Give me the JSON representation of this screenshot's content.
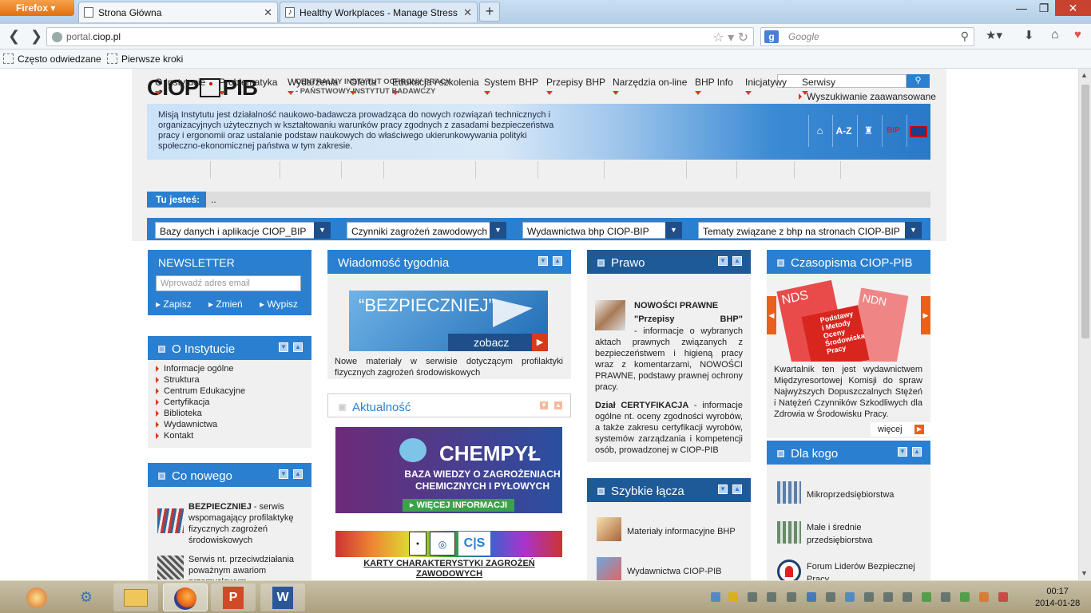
{
  "browser": {
    "menu_button": "Firefox",
    "tabs": [
      {
        "title": "Strona Główna",
        "active": true
      },
      {
        "title": "Healthy Workplaces - Manage Stress",
        "active": false
      }
    ],
    "url_prefix": "portal.",
    "url_domain": "ciop.pl",
    "search_placeholder": "Google",
    "bookmarks": [
      "Często odwiedzane",
      "Pierwsze kroki"
    ]
  },
  "site": {
    "logo_left": "CIOP",
    "logo_right": "PIB",
    "institute_line1": "CENTRALNY INSTYTUT OCHRONY PRACY",
    "institute_line2": "- PAŃSTWOWY INSTYTUT BADAWCZY",
    "advanced_search": "Wyszukiwanie zaawansowane",
    "mission": "Misją Instytutu jest działalność naukowo-badawcza prowadząca do nowych rozwiązań technicznych i organizacyjnych użytecznych w kształtowaniu warunków pracy zgodnych z zasadami bezpieczeństwa pracy i ergonomii oraz ustalanie podstaw naukowych do właściwego ukierunkowywania polityki społeczno-ekonomicznej państwa w tym zakresie.",
    "banner_icons": [
      "home-icon",
      "A-Z",
      "podium-icon",
      "BIP",
      "uk-flag-icon"
    ],
    "nav": [
      "O Instytucie",
      "Problematyka",
      "Wydarzenia",
      "Oferta",
      "Edukacja i szkolenia",
      "System BHP",
      "Przepisy BHP",
      "Narzędzia on-line",
      "BHP Info",
      "Inicjatywy",
      "Serwisy"
    ],
    "breadcrumb_label": "Tu jesteś:",
    "breadcrumb_value": "..",
    "filters": [
      "Bazy danych i aplikacje CIOP_BIP",
      "Czynniki zagrożeń zawodowych",
      "Wydawnictwa bhp CIOP-BIP",
      "Tematy związane z bhp na stronach CIOP-BIP"
    ]
  },
  "newsletter": {
    "title": "NEWSLETTER",
    "placeholder": "Wprowadź adres email",
    "actions": [
      "Zapisz",
      "Zmień",
      "Wypisz"
    ]
  },
  "o_instytucie": {
    "title": "O Instytucie",
    "items": [
      "Informacje ogólne",
      "Struktura",
      "Centrum Edukacyjne",
      "Certyfikacja",
      "Biblioteka",
      "Wydawnictwa",
      "Kontakt"
    ]
  },
  "co_nowego": {
    "title": "Co nowego",
    "item1_bold": "BEZPIECZNIEJ",
    "item1_text": " - serwis wspomagający profilaktykę fizycznych zagrożeń środowiskowych",
    "item2_text": "Serwis nt. przeciwdziałania poważnym awariom przemysłowym"
  },
  "wiadomosc": {
    "title": "Wiadomość tygodnia",
    "banner_text": "“BEZPIECZNIEJ”",
    "banner_button": "zobacz",
    "caption": "Nowe materiały w serwisie dotyczącym profilaktyki fizycznych zagrożeń środowiskowych"
  },
  "aktualnosc": {
    "title": "Aktualność",
    "chempyl_title": "CHEMPYŁ",
    "chempyl_sub1": "BAZA WIEDZY O ZAGROŻENIACH",
    "chempyl_sub2": "CHEMICZNYCH I PYŁOWYCH",
    "chempyl_button": "WIĘCEJ INFORMACJI",
    "karty": "KARTY CHARAKTERYSTYKI ZAGROŻEŃ ZAWODOWYCH"
  },
  "prawo": {
    "title": "Prawo",
    "head": "NOWOŚCI PRAWNE",
    "quote": "\"Przepisy BHP\"",
    "text1": "- informacje o wybranych aktach prawnych związanych z bezpieczeństwem i higieną pracy wraz z komentarzami, NOWOŚCI PRAWNE, podstawy prawnej ochrony pracy.",
    "cert_bold": "Dział CERTYFIKACJA",
    "cert_text": " - informacje ogólne nt. oceny zgodności wyrobów, a także zakresu certyfikacji wyrobów, systemów zarządzania i kompetencji osób, prowadzonej w CIOP-PIB"
  },
  "szybkie": {
    "title": "Szybkie łącza",
    "items": [
      "Materiały informacyjne BHP",
      "Wydawnictwa CIOP-PIB"
    ]
  },
  "czasopisma": {
    "title": "Czasopisma CIOP-PIB",
    "book1": "NDS",
    "book2": "NDN",
    "book_lines": [
      "Podstawy",
      "i Metody",
      "Oceny",
      "Środowiska",
      "Pracy"
    ],
    "text": "Kwartalnik ten jest wydawnictwem Międzyresortowej Komisji do spraw Najwyższych Dopuszczalnych Stężeń i Natężeń Czynników Szkodliwych dla Zdrowia w Środowisku Pracy.",
    "more": "więcej"
  },
  "dla_kogo": {
    "title": "Dla kogo",
    "items": [
      "Mikroprzedsiębiorstwa",
      "Małe i średnie przedsiębiorstwa",
      "Forum Liderów Bezpiecznej Pracy"
    ]
  },
  "taskbar": {
    "time": "00:17",
    "date": "2014-01-28"
  },
  "colors": {
    "accent": "#2a7fd0",
    "dark": "#1e5a98",
    "red": "#d83b17"
  }
}
